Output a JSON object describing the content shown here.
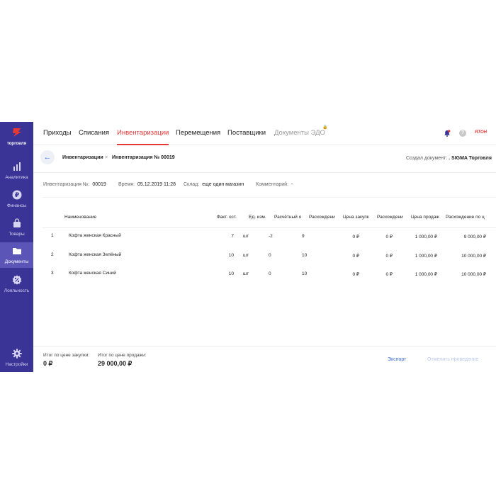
{
  "sidebar": {
    "logo_text": "торговля",
    "items": [
      {
        "label": "Аналитика",
        "icon": "bar-chart-icon"
      },
      {
        "label": "Финансы",
        "icon": "ruble-coin-icon"
      },
      {
        "label": "Товары",
        "icon": "shopping-bag-icon"
      },
      {
        "label": "Документы",
        "icon": "folder-icon",
        "active": true
      },
      {
        "label": "Лояльность",
        "icon": "percent-badge-icon"
      },
      {
        "label": "Настройки",
        "icon": "gear-icon"
      }
    ]
  },
  "tabs": [
    {
      "label": "Приходы"
    },
    {
      "label": "Списания"
    },
    {
      "label": "Инвентаризации",
      "active": true
    },
    {
      "label": "Перемещения"
    },
    {
      "label": "Поставщики"
    },
    {
      "label": "Документы ЭДО",
      "disabled": true
    }
  ],
  "brand_text": "ЯТОН",
  "breadcrumb": {
    "parent": "Инвентаризации",
    "separator": ">",
    "current": "Инвентаризация № 00019"
  },
  "creator": {
    "label": "Создал документ:",
    "value": ". SIGMA Торговля"
  },
  "meta": {
    "number_label": "Инвентаризация №:",
    "number": "00019",
    "time_label": "Время:",
    "time": "05.12.2019 11:28",
    "store_label": "Склад:",
    "store": "еще один магазин",
    "comment_label": "Комментарий:",
    "comment": "-"
  },
  "table": {
    "headers": [
      "Наименование",
      "Факт. ост.",
      "Ед. изм.",
      "Расчётный о",
      "Расхождени",
      "Цена закупк",
      "Расхождени",
      "Цена продаж",
      "Расхождение по ц"
    ],
    "rows": [
      {
        "n": "1",
        "name": "Кофта женская Красный",
        "fact": "7",
        "unit": "шт",
        "calc": "-2",
        "diff": "9",
        "buy": "0 ₽",
        "diff_buy": "0 ₽",
        "sell": "1 000,00 ₽",
        "diff_sell": "9 000,00 ₽"
      },
      {
        "n": "2",
        "name": "Кофта женская Зелёный",
        "fact": "10",
        "unit": "шт",
        "calc": "0",
        "diff": "10",
        "buy": "0 ₽",
        "diff_buy": "0 ₽",
        "sell": "1 000,00 ₽",
        "diff_sell": "10 000,00 ₽"
      },
      {
        "n": "3",
        "name": "Кофта женская Синий",
        "fact": "10",
        "unit": "шт",
        "calc": "0",
        "diff": "10",
        "buy": "0 ₽",
        "diff_buy": "0 ₽",
        "sell": "1 000,00 ₽",
        "diff_sell": "10 000,00 ₽"
      }
    ]
  },
  "footer": {
    "total_buy_label": "Итог по цене закупки:",
    "total_buy": "0 ₽",
    "total_sell_label": "Итог по цене продажи:",
    "total_sell": "29 000,00 ₽",
    "export_label": "Экспорт",
    "cancel_label": "Отменить проведение"
  },
  "colors": {
    "sidebar": "#3a3497",
    "accent": "#e53935",
    "link": "#3a6fd8"
  }
}
